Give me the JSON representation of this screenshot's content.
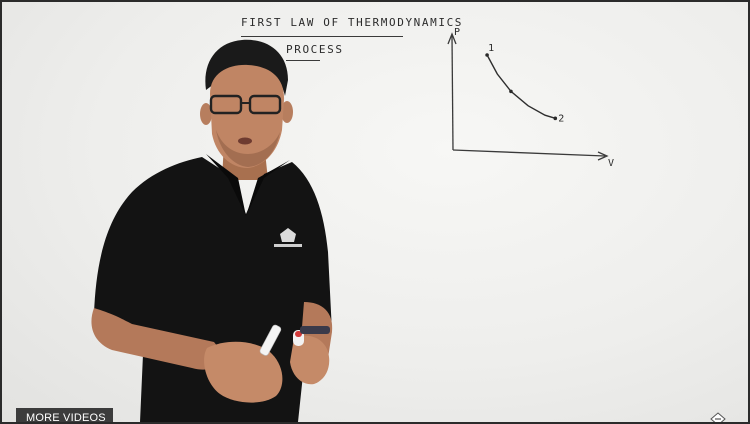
{
  "whiteboard": {
    "title": "FIRST LAW OF THERMODYNAMICS",
    "subtitle": "PROCESS"
  },
  "chart_data": {
    "type": "line",
    "xlabel": "V",
    "ylabel": "P",
    "series": [
      {
        "x": [
          1.0,
          1.3,
          1.7,
          2.2,
          2.7,
          3.0
        ],
        "y": [
          3.0,
          2.4,
          1.85,
          1.4,
          1.1,
          1.0
        ]
      }
    ],
    "point_labels": [
      "1",
      "2"
    ],
    "xlim": [
      0,
      4.4
    ],
    "ylim": [
      0,
      3.6
    ]
  },
  "controls": {
    "more_videos_label": "MORE VIDEOS"
  },
  "icons": {
    "corner": "share-icon"
  },
  "colors": {
    "board": "#efefed",
    "marker": "#2c2c2c",
    "shirt": "#111111",
    "button_bg": "#3c3c3c"
  }
}
